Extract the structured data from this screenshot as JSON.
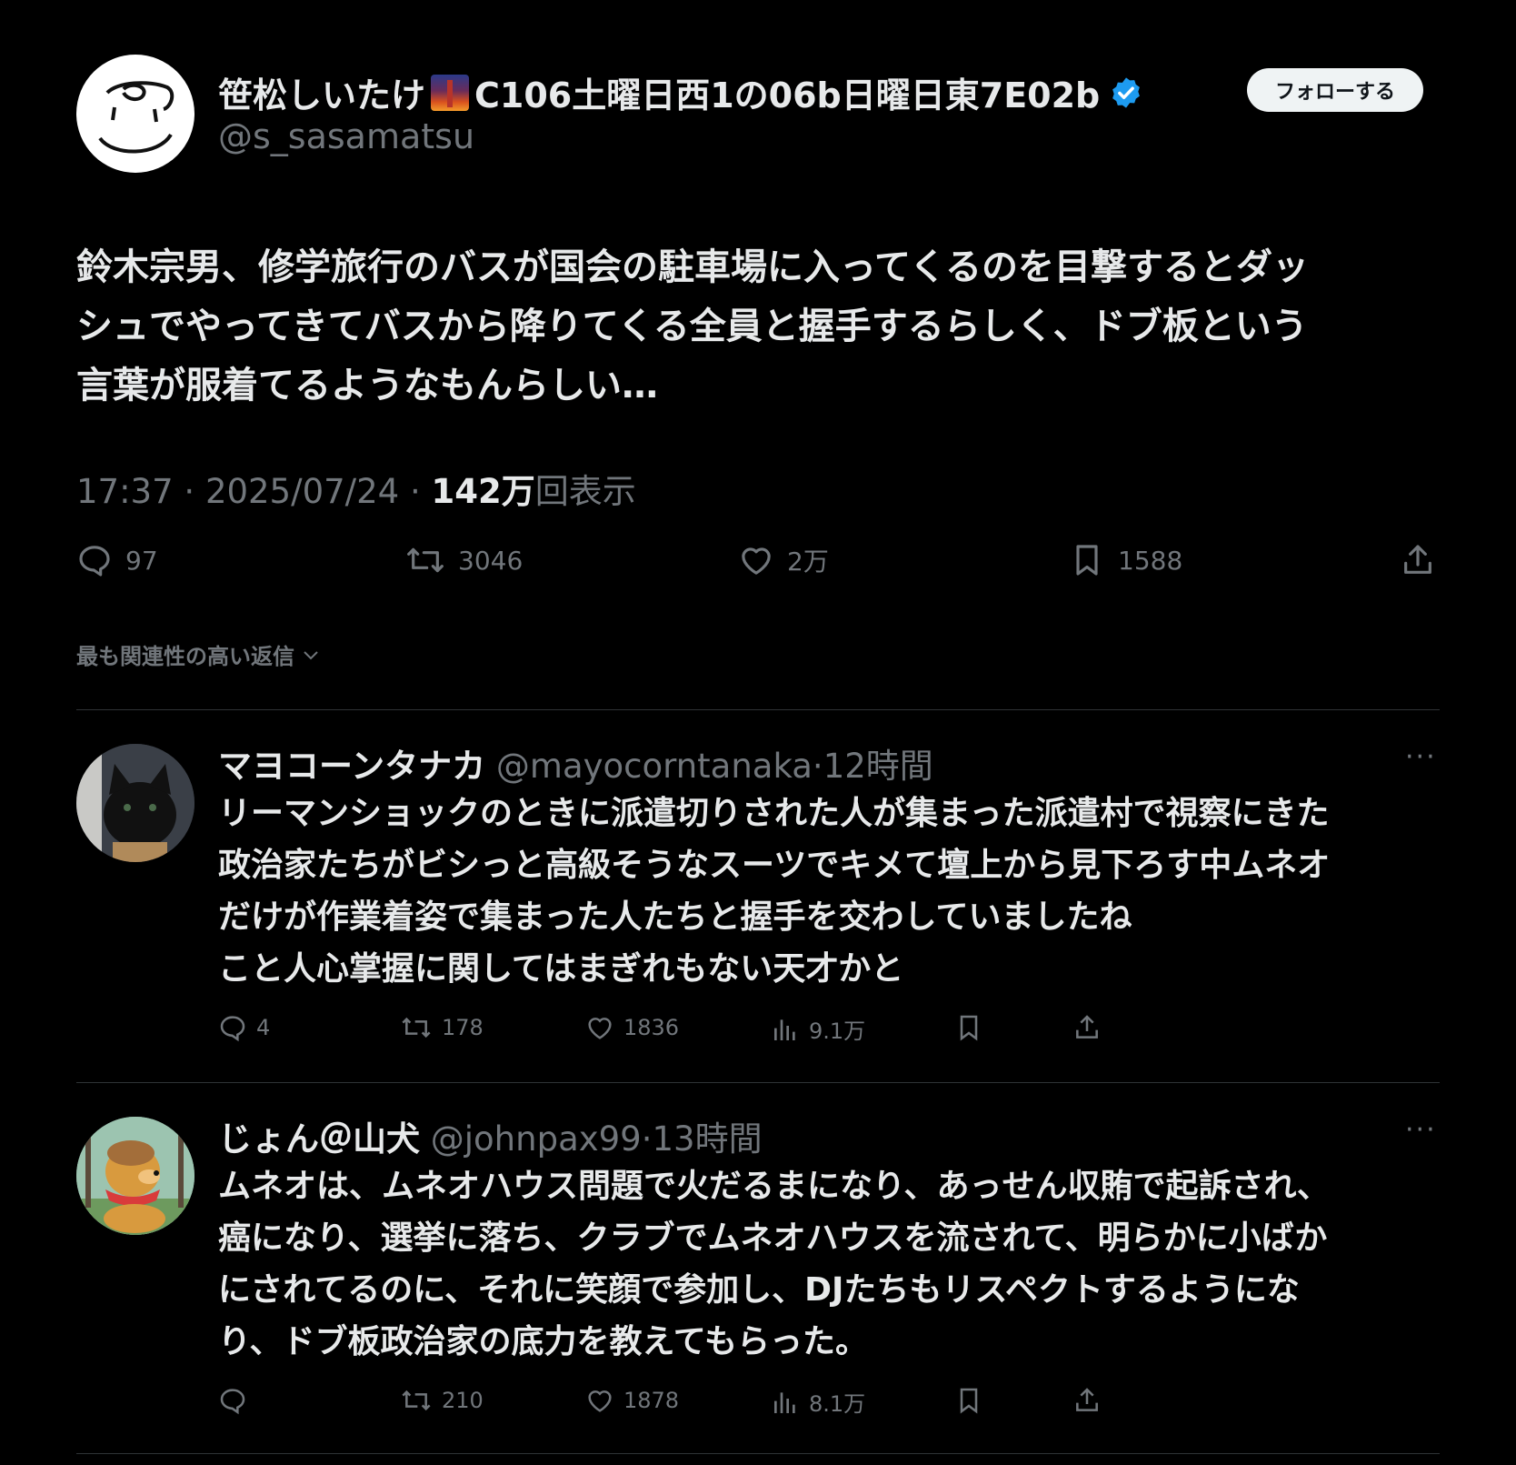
{
  "tweet": {
    "display_name_start": "笹松しいたけ",
    "display_name_end": "C106土曜日西1の06b日曜日東7E02b",
    "handle": "@s_sasamatsu",
    "follow_label": "フォローする",
    "text_lines": [
      "鈴木宗男、修学旅行のバスが国会の駐車場に入ってくるのを目撃するとダッ",
      "シュでやってきてバスから降りてくる全員と握手するらしく、ドブ板という",
      "言葉が服着てるようなもんらしい…"
    ],
    "time": "17:37",
    "date": "2025/07/24",
    "views_count": "142万",
    "views_label": "回表示",
    "separator": "·",
    "stats": {
      "replies": "97",
      "retweets": "3046",
      "likes": "2万",
      "bookmarks": "1588"
    }
  },
  "sort_label": "最も関連性の高い返信",
  "replies": [
    {
      "name": "マヨコーンタナカ",
      "handle": "@mayocorntanaka",
      "time": "12時間",
      "text_lines": [
        "リーマンショックのときに派遣切りされた人が集まった派遣村で視察にきた",
        "政治家たちがビシっと高級そうなスーツでキメて壇上から見下ろす中ムネオ",
        "だけが作業着姿で集まった人たちと握手を交わしていましたね",
        "こと人心掌握に関してはまぎれもない天才かと"
      ],
      "stats": {
        "replies": "4",
        "retweets": "178",
        "likes": "1836",
        "views": "9.1万"
      }
    },
    {
      "name": "じょん＠山犬",
      "handle": "@johnpax99",
      "time": "13時間",
      "text_lines": [
        "ムネオは、ムネオハウス問題で火だるまになり、あっせん収賄で起訴され、",
        "癌になり、選挙に落ち、クラブでムネオハウスを流されて、明らかに小ばか",
        "にされてるのに、それに笑顔で参加し、DJたちもリスペクトするようにな",
        "り、ドブ板政治家の底力を教えてもらった。"
      ],
      "stats": {
        "replies": "",
        "retweets": "210",
        "likes": "1878",
        "views": "8.1万"
      }
    }
  ],
  "more_glyph": "···",
  "colors": {
    "background": "#000000",
    "text": "#e7e9ea",
    "muted": "#71767b",
    "verified": "#1d9bf0",
    "divider": "#2f3336"
  }
}
